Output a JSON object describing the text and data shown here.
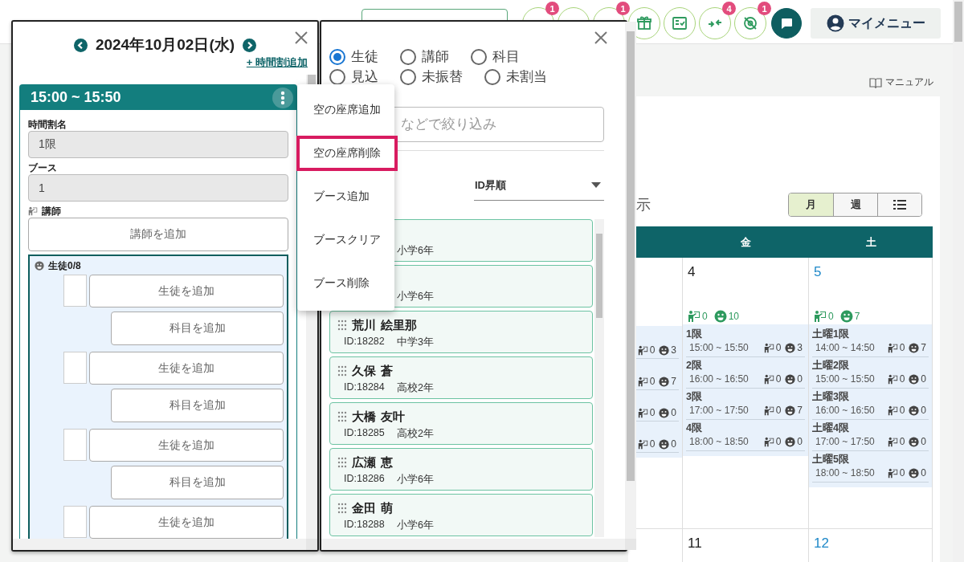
{
  "toolbar": {
    "icon_buttons": [
      {
        "kind": "covered",
        "badge": "1"
      },
      {
        "kind": "covered"
      },
      {
        "kind": "covered",
        "badge": "1"
      },
      {
        "kind": "gift"
      },
      {
        "kind": "checklist"
      },
      {
        "kind": "merge",
        "badge": "4"
      },
      {
        "kind": "no-location",
        "badge": "1"
      },
      {
        "kind": "chat"
      }
    ],
    "menu_button": "マイメニュー"
  },
  "manual_link": "マニュアル",
  "calendar": {
    "title_fragment": "示",
    "views": [
      {
        "kind": "month",
        "label": "月",
        "selected": true
      },
      {
        "kind": "week",
        "label": "週",
        "selected": false
      },
      {
        "kind": "list",
        "selected": false
      }
    ],
    "columns": [
      {
        "day": "金"
      },
      {
        "day": "土"
      }
    ],
    "weeks": [
      {
        "partial_cell": {
          "slots": [
            {
              "teachers": "0",
              "students": "3"
            },
            {
              "teachers": "0",
              "students": "7"
            },
            {
              "teachers": "0",
              "students": "0"
            },
            {
              "teachers": "0",
              "students": "0"
            }
          ]
        },
        "cells": [
          {
            "date": "4",
            "saturday": false,
            "totals": {
              "teachers": "0",
              "students": "10"
            },
            "slots": [
              {
                "name": "1限",
                "time": "15:00 ~ 15:50",
                "teachers": "0",
                "students": "3"
              },
              {
                "name": "2限",
                "time": "16:00 ~ 16:50",
                "teachers": "0",
                "students": "0"
              },
              {
                "name": "3限",
                "time": "17:00 ~ 17:50",
                "teachers": "0",
                "students": "7"
              },
              {
                "name": "4限",
                "time": "18:00 ~ 18:50",
                "teachers": "0",
                "students": "0"
              }
            ]
          },
          {
            "date": "5",
            "saturday": true,
            "totals": {
              "teachers": "0",
              "students": "7"
            },
            "slots": [
              {
                "name": "土曜1限",
                "time": "14:00 ~ 14:50",
                "teachers": "0",
                "students": "7"
              },
              {
                "name": "土曜2限",
                "time": "15:00 ~ 15:50",
                "teachers": "0",
                "students": "0"
              },
              {
                "name": "土曜3限",
                "time": "16:00 ~ 16:50",
                "teachers": "0",
                "students": "0"
              },
              {
                "name": "土曜4限",
                "time": "17:00 ~ 17:50",
                "teachers": "0",
                "students": "0"
              },
              {
                "name": "土曜5限",
                "time": "18:00 ~ 18:50",
                "teachers": "0",
                "students": "0"
              }
            ]
          }
        ]
      },
      {
        "cells": [
          {
            "date": "11",
            "saturday": false
          },
          {
            "date": "12",
            "saturday": true
          }
        ]
      }
    ]
  },
  "schedule_panel": {
    "date": "2024年10月02日(水)",
    "add_link": "+ 時間割追加",
    "period": {
      "time": "15:00 ~ 15:50",
      "name_label": "時間割名",
      "name_value": "1限",
      "booth_label": "ブース",
      "booth_value": "1",
      "teacher_label": "講師",
      "teacher_button": "講師を追加",
      "students_label": "生徒0/8",
      "seats": [
        {
          "student_button": "生徒を追加",
          "subject_button": "科目を追加"
        },
        {
          "student_button": "生徒を追加",
          "subject_button": "科目を追加"
        },
        {
          "student_button": "生徒を追加",
          "subject_button": "科目を追加"
        },
        {
          "student_button": "生徒を追加"
        }
      ]
    }
  },
  "context_menu": {
    "items": [
      {
        "label": "空の座席追加",
        "selected": false
      },
      {
        "label": "空の座席削除",
        "selected": true
      },
      {
        "label": "ブース追加",
        "selected": false
      },
      {
        "label": "ブースクリア",
        "selected": false
      },
      {
        "label": "ブース削除",
        "selected": false
      }
    ]
  },
  "student_panel": {
    "filters": [
      {
        "label": "生徒",
        "selected": true
      },
      {
        "label": "講師",
        "selected": false
      },
      {
        "label": "科目",
        "selected": false
      },
      {
        "label": "見込",
        "selected": false
      },
      {
        "label": "未振替",
        "selected": false
      },
      {
        "label": "未割当",
        "selected": false
      }
    ],
    "search": {
      "placeholder": "などで絞り込み"
    },
    "sort": {
      "value": "ID昇順"
    },
    "students": [
      {
        "grade": "小学6年"
      },
      {
        "grade": "小学6年"
      },
      {
        "surname": "荒川",
        "given_name": "絵里那",
        "id": "ID:18282",
        "grade": "中学3年"
      },
      {
        "surname": "久保",
        "given_name": "蒼",
        "id": "ID:18284",
        "grade": "高校2年"
      },
      {
        "surname": "大橋",
        "given_name": "友叶",
        "id": "ID:18285",
        "grade": "高校2年"
      },
      {
        "surname": "広瀬",
        "given_name": "恵",
        "id": "ID:18286",
        "grade": "小学6年"
      },
      {
        "surname": "金田",
        "given_name": "萌",
        "id": "ID:18288",
        "grade": "小学6年"
      }
    ]
  }
}
